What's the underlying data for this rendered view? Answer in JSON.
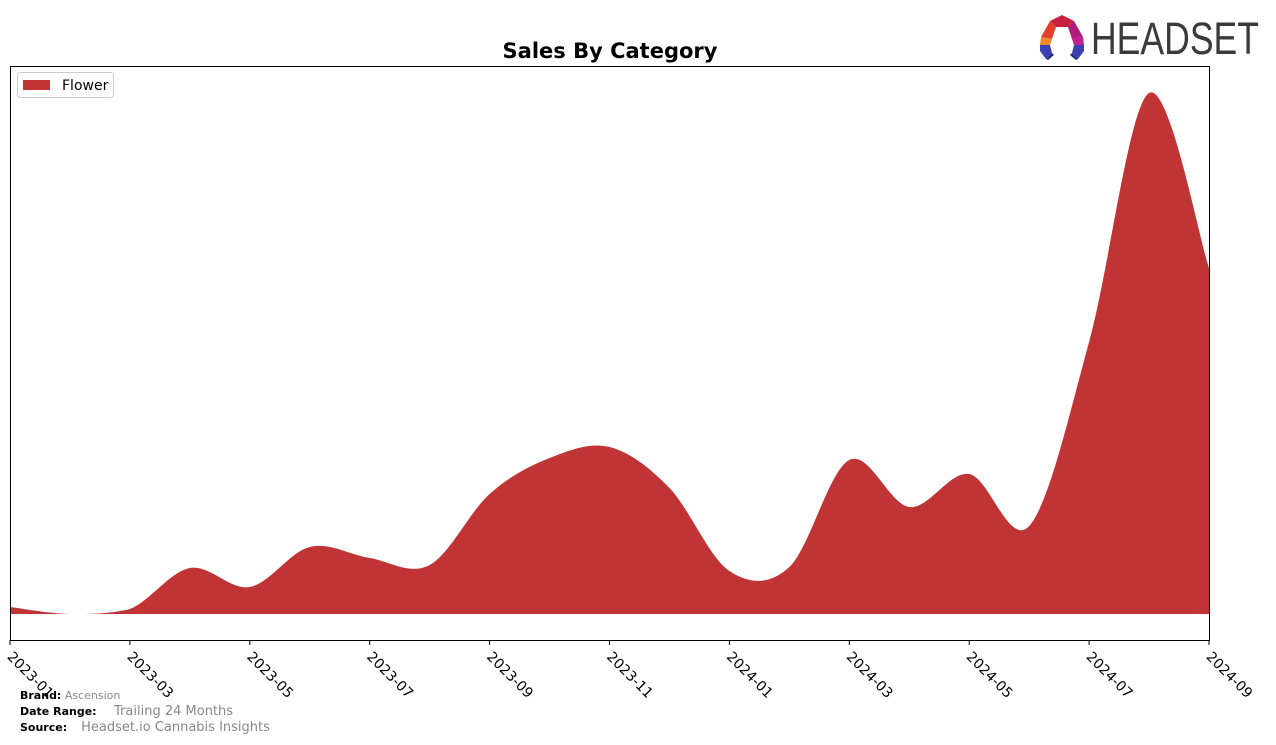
{
  "logo": {
    "text": "HEADSET",
    "icon": "headset-logo-icon"
  },
  "footer": {
    "brand_label": "Brand:",
    "brand_value": "Ascension",
    "range_label": "Date Range:",
    "range_value": "Trailing 24 Months",
    "source_label": "Source:",
    "source_value": "Headset.io Cannabis Insights"
  },
  "colors": {
    "flower": "#c13435",
    "axis": "#000000"
  },
  "chart_data": {
    "type": "area",
    "title": "Sales By Category",
    "xlabel": "",
    "ylabel": "",
    "grid": false,
    "legend": {
      "position": "top-left",
      "entries": [
        "Flower"
      ]
    },
    "x": [
      "2023-01",
      "2023-02",
      "2023-03",
      "2023-04",
      "2023-05",
      "2023-06",
      "2023-07",
      "2023-08",
      "2023-09",
      "2023-10",
      "2023-11",
      "2023-12",
      "2024-01",
      "2024-02",
      "2024-03",
      "2024-04",
      "2024-05",
      "2024-06",
      "2024-07",
      "2024-08",
      "2024-09"
    ],
    "x_ticks": [
      "2023-01",
      "2023-03",
      "2023-05",
      "2023-07",
      "2023-09",
      "2023-11",
      "2024-01",
      "2024-03",
      "2024-05",
      "2024-07",
      "2024-09"
    ],
    "series": [
      {
        "name": "Flower",
        "color": "#c13435",
        "values": [
          7,
          0,
          5,
          46,
          27,
          67,
          56,
          49,
          120,
          156,
          167,
          126,
          43,
          47,
          154,
          107,
          140,
          88,
          272,
          521,
          346
        ]
      }
    ],
    "ylim": [
      -26,
      548
    ],
    "y_ticks_visible": false
  }
}
